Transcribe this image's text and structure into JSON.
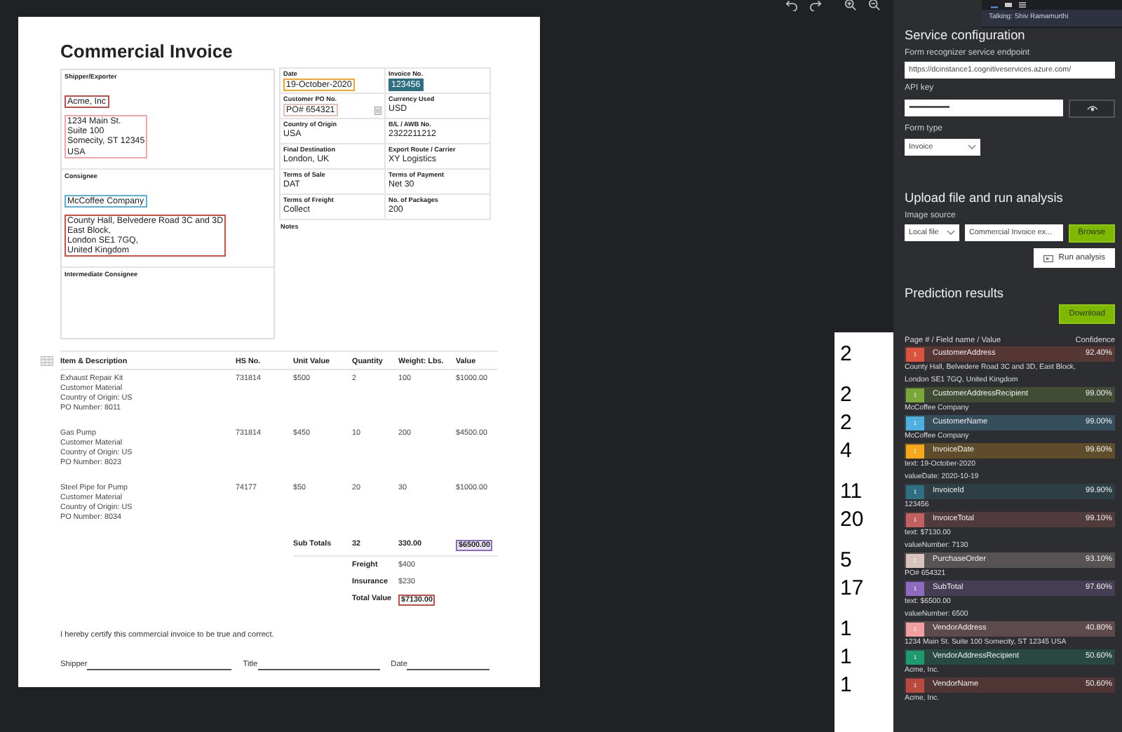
{
  "document": {
    "title": "Commercial Invoice",
    "parties": [
      {
        "label": "Shipper/Exporter",
        "groups": [
          {
            "lines": [
              "Acme, Inc"
            ],
            "color": "#c0504d"
          },
          {
            "lines": [
              "1234 Main St.",
              "Suite 100",
              "Somecity, ST 12345",
              "USA"
            ],
            "color": "#f4a6a6"
          }
        ]
      },
      {
        "label": "Consignee",
        "groups": [
          {
            "lines": [
              "McCoffee Company"
            ],
            "color": "#5bb0de"
          },
          {
            "lines": [
              "County Hall, Belvedere Road 3C and 3D",
              "East Block,",
              "London SE1 7GQ,",
              "United Kingdom"
            ],
            "color": "#d0503c"
          }
        ]
      },
      {
        "label": "Intermediate Consignee"
      }
    ],
    "fields": [
      {
        "label": "Date",
        "value": "19-October-2020",
        "color": "#f5a623"
      },
      {
        "label": "Invoice No.",
        "value": "123456",
        "color": "#2f6f82",
        "filled": true
      },
      {
        "label": "Customer PO No.",
        "value": "PO# 654321",
        "color": "#e0c0b8",
        "attachment": true
      },
      {
        "label": "Currency Used",
        "value": "USD"
      },
      {
        "label": "Country of Origin",
        "value": "USA"
      },
      {
        "label": "B/L / AWB No.",
        "value": "2322211212"
      },
      {
        "label": "Final Destination",
        "value": "London, UK"
      },
      {
        "label": "Export Route / Carrier",
        "value": "XY Logistics"
      },
      {
        "label": "Terms of Sale",
        "value": "DAT"
      },
      {
        "label": "Terms of Payment",
        "value": "Net 30"
      },
      {
        "label": "Terms of Freight",
        "value": "Collect"
      },
      {
        "label": "No. of Packages",
        "value": "200"
      }
    ],
    "notes_label": "Notes",
    "items_table": {
      "columns": [
        "Item & Description",
        "HS No.",
        "Unit Value",
        "Quantity",
        "Weight: Lbs.",
        "Value"
      ],
      "rows": [
        {
          "cells": [
            "Exhaust Repair Kit\nCustomer Material\nCountry of Origin: US\nPO Number: 8011",
            "731814",
            "$500",
            "2",
            "100",
            "$1000.00"
          ]
        },
        {
          "cells": [
            "Gas Pump\nCustomer Material\nCountry of Origin: US\nPO Number: 8023",
            "731814",
            "$450",
            "10",
            "200",
            "$4500.00"
          ]
        },
        {
          "cells": [
            "Steel Pipe for Pump\nCustomer Material\nCountry of Origin: US\nPO Number: 8034",
            "74177",
            "$50",
            "20",
            "30",
            "$1000.00"
          ]
        }
      ]
    },
    "subtotals": {
      "label": "Sub Totals",
      "quantity": "32",
      "weight": "330.00",
      "value": "$6500.00",
      "color": "#8e6bbf"
    },
    "charges": [
      {
        "label": "Freight",
        "value": "$400"
      },
      {
        "label": "Insurance",
        "value": "$230"
      },
      {
        "label": "Total Value",
        "value": "$7130.00",
        "color": "#c0504d"
      }
    ],
    "certification": "I hereby certify this commercial invoice to be true and correct.",
    "signatures": [
      "Shipper",
      "Title",
      "Date"
    ]
  },
  "panel": {
    "service_configuration": {
      "title": "Service configuration",
      "endpoint": {
        "label": "Form recognizer service endpoint",
        "value": "https://dcinstance1.cognitiveservices.azure.com/"
      },
      "api_key": {
        "label": "API key",
        "value": "••••••••••••••••••••••••••••••••"
      },
      "form_type": {
        "label": "Form type",
        "value": "Invoice"
      }
    },
    "upload": {
      "title": "Upload file and run analysis",
      "image_source_label": "Image source",
      "image_source": "Local file",
      "file_name": "Commercial Invoice ex...",
      "browse_button": "Browse",
      "run_button": "Run analysis"
    },
    "predictions": {
      "title": "Prediction results",
      "download_button": "Download",
      "header_left": "Page # / Field name / Value",
      "header_right": "Confidence",
      "items": [
        {
          "number": "2",
          "page": "1",
          "name": "CustomerAddress",
          "confidence": "92.40%",
          "color": "#d9533f",
          "value_lines": [
            "County Hall, Belvedere Road 3C and 3D, East Block,",
            "London SE1 7GQ, United Kingdom"
          ]
        },
        {
          "number": "2",
          "page": "1",
          "name": "CustomerAddressRecipient",
          "confidence": "99.00%",
          "color": "#7aa63a",
          "value_lines": [
            "McCoffee Company"
          ]
        },
        {
          "number": "2",
          "page": "1",
          "name": "CustomerName",
          "confidence": "99.00%",
          "color": "#4fb0e0",
          "value_lines": [
            "McCoffee Company"
          ]
        },
        {
          "number": "4",
          "page": "1",
          "name": "InvoiceDate",
          "confidence": "99.60%",
          "color": "#f5a81c",
          "value_lines": [
            "text: 19-October-2020",
            "valueDate: 2020-10-19"
          ]
        },
        {
          "number": "11",
          "page": "1",
          "name": "InvoiceId",
          "confidence": "99.90%",
          "color": "#2f6f82",
          "value_lines": [
            "123456"
          ]
        },
        {
          "number": "20",
          "page": "1",
          "name": "InvoiceTotal",
          "confidence": "99.10%",
          "color": "#c06060",
          "value_lines": [
            "text: $7130.00",
            "valueNumber: 7130"
          ]
        },
        {
          "number": "5",
          "page": "1",
          "name": "PurchaseOrder",
          "confidence": "93.10%",
          "color": "#d8c4bc",
          "value_lines": [
            "PO# 654321"
          ]
        },
        {
          "number": "17",
          "page": "1",
          "name": "SubTotal",
          "confidence": "97.60%",
          "color": "#8e6bbf",
          "value_lines": [
            "text: $6500.00",
            "valueNumber: 6500"
          ]
        },
        {
          "number": "1",
          "page": "1",
          "name": "VendorAddress",
          "confidence": "40.80%",
          "color": "#f0a0a0",
          "value_lines": [
            "1234 Main St. Suite 100 Somecity, ST 12345 USA"
          ]
        },
        {
          "number": "1",
          "page": "1",
          "name": "VendorAddressRecipient",
          "confidence": "50.60%",
          "color": "#1e9a6e",
          "value_lines": [
            "Acme, Inc."
          ]
        },
        {
          "number": "1",
          "page": "1",
          "name": "VendorName",
          "confidence": "50.60%",
          "color": "#b84a40",
          "value_lines": [
            "Acme, Inc."
          ]
        }
      ]
    }
  },
  "tooltip": {
    "text": "Talking: Shiv Ramamurthi"
  }
}
